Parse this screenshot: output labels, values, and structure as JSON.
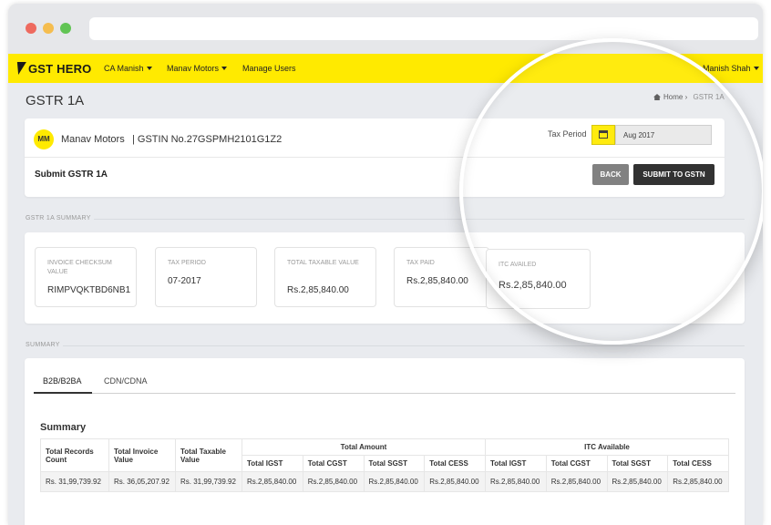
{
  "nav": {
    "brand": "GST HERO",
    "items": [
      "CA Manish",
      "Manav Motors",
      "Manage Users"
    ],
    "user": "Manish Shah"
  },
  "page": {
    "title": "GSTR 1A",
    "breadcrumb_home": "Home",
    "breadcrumb_current": "GSTR 1A"
  },
  "header_card": {
    "avatar": "MM",
    "company": "Manav Motors",
    "gstin": "| GSTIN No.27GSPMH2101G1Z2",
    "tax_period_label": "Tax Period",
    "tax_period_value": "Aug 2017",
    "submit_title": "Submit GSTR 1A",
    "back_label": "BACK",
    "submit_label": "SUBMIT TO GSTN"
  },
  "gstr_summary": {
    "section_label": "GSTR 1A SUMMARY",
    "boxes": [
      {
        "label": "INVOICE CHECKSUM VALUE",
        "value": "RIMPVQKTBD6NB1"
      },
      {
        "label": "TAX PERIOD",
        "value": "07-2017"
      },
      {
        "label": "TOTAL TAXABLE VALUE",
        "value": "Rs.2,85,840.00"
      },
      {
        "label": "TAX PAID",
        "value": "Rs.2,85,840.00"
      },
      {
        "label": "ITC AVAILED",
        "value": "Rs.2,85,840.00"
      }
    ]
  },
  "summary": {
    "section_label": "SUMMARY",
    "tabs": [
      "B2B/B2BA",
      "CDN/CDNA"
    ],
    "heading": "Summary",
    "table": {
      "headers": {
        "total_records": "Total Records Count",
        "total_invoice": "Total Invoice Value",
        "total_taxable": "Total Taxable Value",
        "total_amount": "Total Amount",
        "itc_available": "ITC Available",
        "sub": [
          "Total IGST",
          "Total CGST",
          "Total SGST",
          "Total CESS",
          "Total IGST",
          "Total CGST",
          "Total SGST",
          "Total CESS"
        ]
      },
      "row": [
        "Rs. 31,99,739.92",
        "Rs. 36,05,207.92",
        "Rs. 31,99,739.92",
        "Rs.2,85,840.00",
        "Rs.2,85,840.00",
        "Rs.2,85,840.00",
        "Rs.2,85,840.00",
        "Rs.2,85,840.00",
        "Rs.2,85,840.00",
        "Rs.2,85,840.00",
        "Rs.2,85,840.00"
      ]
    }
  },
  "colors": {
    "accent": "#ffea00",
    "dark_button": "#262626",
    "gray_button": "#7a7a7a"
  }
}
